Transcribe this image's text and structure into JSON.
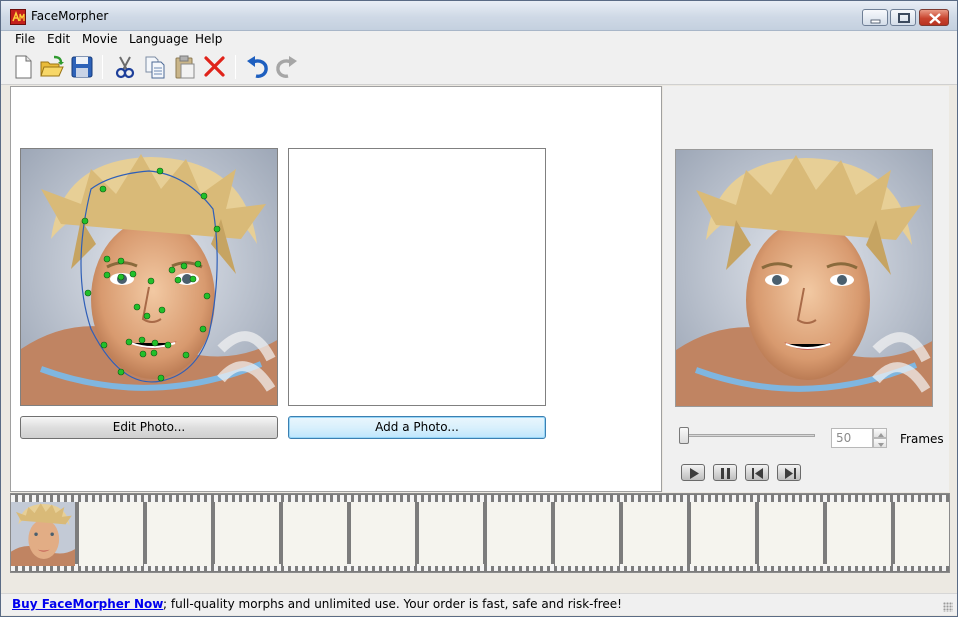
{
  "window": {
    "title": "FaceMorpher",
    "icon": "facemorpher-app-icon",
    "controls": [
      "minimize-icon",
      "maximize-icon",
      "close-icon"
    ]
  },
  "menu": {
    "items": [
      "File",
      "Edit",
      "Movie",
      "Language",
      "Help"
    ]
  },
  "toolbar": {
    "buttons": [
      "new-file-icon",
      "open-folder-icon",
      "save-disk-icon",
      "cut-scissors-icon",
      "copy-icon",
      "paste-icon",
      "delete-x-icon",
      "undo-icon",
      "redo-icon"
    ]
  },
  "workspace": {
    "edit_photo_label": "Edit Photo...",
    "add_photo_label": "Add a Photo..."
  },
  "preview": {
    "frames_value": "50",
    "frames_label": "Frames",
    "slider_fraction": 0.0,
    "playback": [
      "play-icon",
      "pause-icon",
      "skip-back-icon",
      "skip-forward-icon"
    ]
  },
  "filmstrip": {
    "frame_count": 13
  },
  "statusbar": {
    "link_text": "Buy FaceMorpher Now",
    "message": "; full-quality morphs and unlimited use. Your order is fast, safe and risk-free!"
  },
  "colors": {
    "accent_blue": "#1e5fbf",
    "link": "#0000ee",
    "close_red": "#c9452f",
    "marker_green": "#22c02a"
  }
}
